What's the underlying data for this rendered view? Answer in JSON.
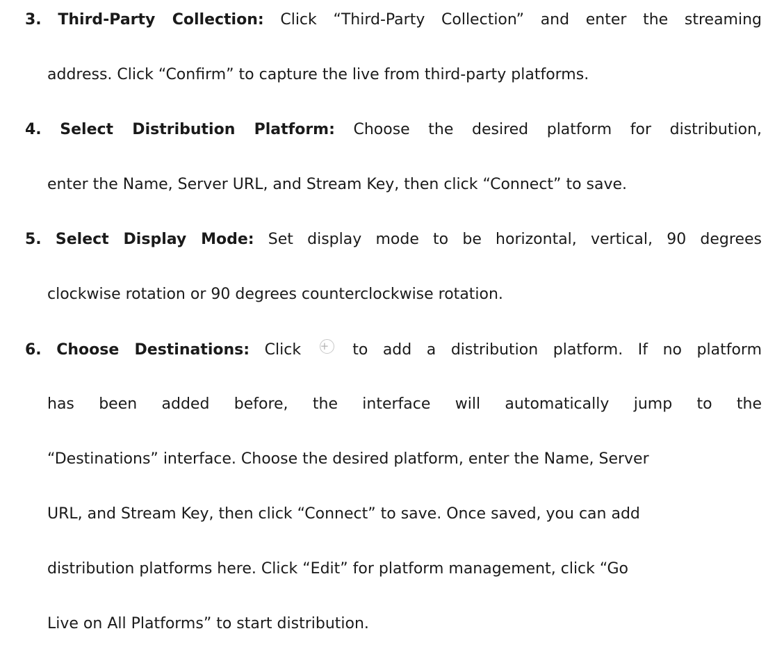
{
  "steps": [
    {
      "num": "3.",
      "heading": "Third-Party Collection:",
      "line1_rest": " Click “Third-Party Collection”  and enter the streaming",
      "line2": "address. Click  “Confirm”  to capture the live from third-party platforms."
    },
    {
      "num": "4.",
      "heading": "Select Distribution Platform:",
      "line1_rest": " Choose the desired platform for distribution,",
      "line2": "enter the Name, Server URL, and Stream Key, then click  “Connect”  to save."
    },
    {
      "num": "5.",
      "heading": "Select Display Mode:",
      "line1_rest": " Set display mode to be horizontal, vertical, 90 degrees",
      "line2": "clockwise rotation or 90 degrees counterclockwise rotation."
    },
    {
      "num": "6.",
      "heading": "Choose Destinations:",
      "line1_pre": " Click",
      "icon": "plus-circle-icon",
      "icon_glyph": "+",
      "line1_post": "to add a distribution platform. If no platform",
      "line2": "has been added before, the interface will automatically jump to the",
      "line3": "“Destinations”  interface. Choose the desired platform, enter the Name, Server",
      "line4": "URL, and Stream Key, then click “Connect”  to save. Once saved, you can add",
      "line5": "distribution platforms here. Click “Edit” for platform management, click  “Go",
      "line6": "Live on All Platforms” to start distribution."
    }
  ]
}
